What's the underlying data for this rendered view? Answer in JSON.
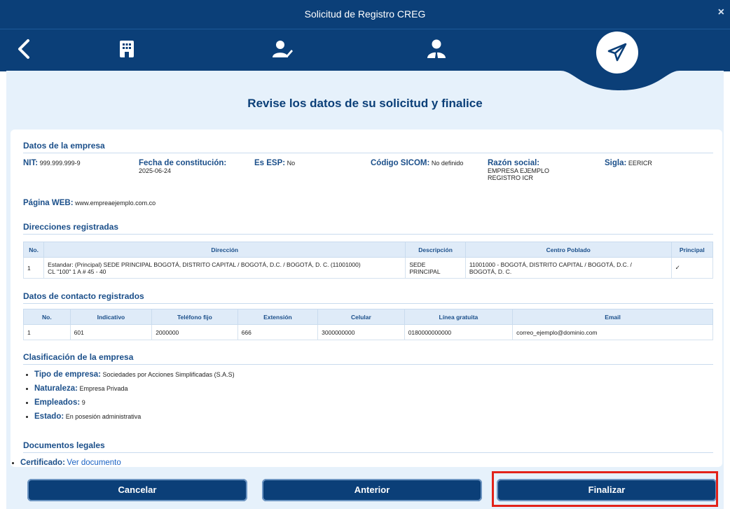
{
  "window": {
    "title": "Solicitud de Registro CREG",
    "close_glyph": "×"
  },
  "steps": [
    {
      "icon": "back-arrow-icon"
    },
    {
      "icon": "building-icon"
    },
    {
      "icon": "user-edit-icon"
    },
    {
      "icon": "user-suit-icon"
    },
    {
      "icon": "paper-plane-icon",
      "active": true
    }
  ],
  "page": {
    "heading": "Revise los datos de su solicitud y finalice"
  },
  "empresa": {
    "section_title": "Datos de la empresa",
    "nit_label": "NIT:",
    "nit": "999.999.999-9",
    "fecha_label": "Fecha de constitución:",
    "fecha": "2025-06-24",
    "esp_label": "Es ESP:",
    "esp": "No",
    "sicom_label": "Código SICOM:",
    "sicom": "No definido",
    "razon_label": "Razón social:",
    "razon_line1": "EMPRESA EJEMPLO",
    "razon_line2": "REGISTRO ICR",
    "sigla_label": "Sigla:",
    "sigla": "EERICR",
    "web_label": "Página WEB:",
    "web": "www.empreaejemplo.com.co"
  },
  "direcciones": {
    "section_title": "Direcciones registradas",
    "headers": [
      "No.",
      "Dirección",
      "Descripción",
      "Centro Poblado",
      "Principal"
    ],
    "rows": [
      {
        "no": "1",
        "direccion_line1": "Estandar: (Principal) SEDE PRINCIPAL BOGOTÁ, DISTRITO CAPITAL / BOGOTÁ, D.C. / BOGOTÁ, D. C. (11001000)",
        "direccion_line2": "CL \"100\" 1 A # 45 - 40",
        "descripcion_line1": "SEDE",
        "descripcion_line2": "PRINCIPAL",
        "centro_line1": "11001000 - BOGOTÁ, DISTRITO CAPITAL / BOGOTÁ, D.C. /",
        "centro_line2": "BOGOTÁ, D. C.",
        "principal": "✓"
      }
    ]
  },
  "contacto": {
    "section_title": "Datos de contacto registrados",
    "headers": [
      "No.",
      "Indicativo",
      "Teléfono fijo",
      "Extensión",
      "Celular",
      "Línea gratuita",
      "Email"
    ],
    "rows": [
      {
        "no": "1",
        "indicativo": "601",
        "telefono": "2000000",
        "extension": "666",
        "celular": "3000000000",
        "linea": "0180000000000",
        "email": "correo_ejemplo@dominio.com"
      }
    ]
  },
  "clasificacion": {
    "section_title": "Clasificación de la empresa",
    "items": [
      {
        "label": "Tipo de empresa:",
        "value": "Sociedades por Acciones Simplificadas (S.A.S)"
      },
      {
        "label": "Naturaleza:",
        "value": "Empresa Privada"
      },
      {
        "label": "Empleados:",
        "value": "9"
      },
      {
        "label": "Estado:",
        "value": "En posesión administrativa"
      }
    ]
  },
  "documentos": {
    "section_title": "Documentos legales",
    "items": [
      {
        "label": "Certificado:",
        "link": "Ver documento"
      }
    ]
  },
  "buttons": {
    "cancel": "Cancelar",
    "previous": "Anterior",
    "finish": "Finalizar"
  },
  "colors": {
    "primary": "#0b3f78",
    "background": "#e6f1fb",
    "accent_text": "#1b4f8a",
    "highlight": "#e2231a"
  }
}
